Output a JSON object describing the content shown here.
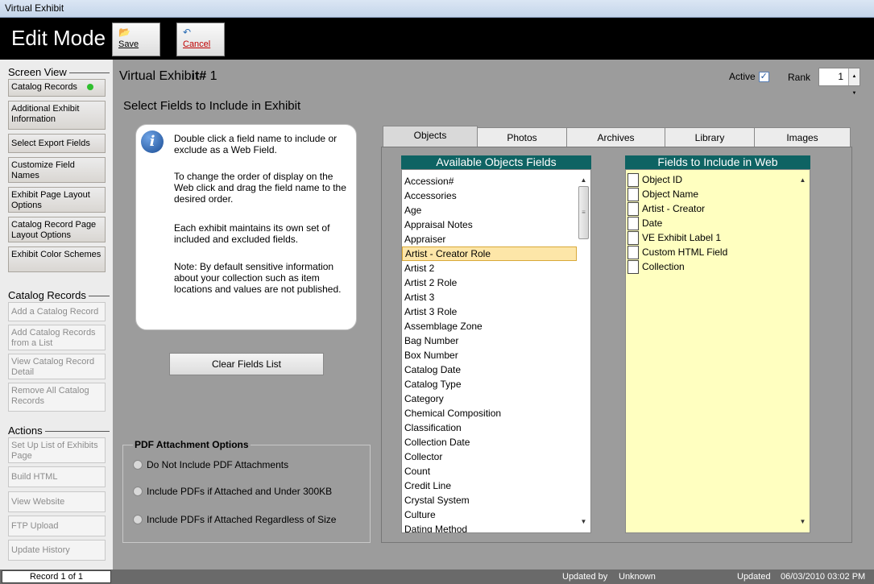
{
  "window": {
    "title": "Virtual Exhibit"
  },
  "toolbar": {
    "mode": "Edit Mode",
    "save_label": "Save",
    "cancel_label": "Cancel"
  },
  "sidebar": {
    "screen_view_heading": "Screen View",
    "screen_view_items": [
      "Catalog Records",
      "Additional Exhibit Information",
      "Select Export Fields",
      "Customize Field Names",
      "Exhibit Page Layout Options",
      "Catalog Record Page Layout Options",
      "Exhibit Color Schemes"
    ],
    "catalog_heading": "Catalog Records",
    "catalog_items": [
      "Add a Catalog Record",
      "Add Catalog Records from a List",
      "View Catalog Record Detail",
      "Remove All Catalog Records"
    ],
    "actions_heading": "Actions",
    "action_items": [
      "Set Up List of Exhibits Page",
      "Build HTML",
      "View Website",
      "FTP Upload",
      "Update History"
    ]
  },
  "header": {
    "title_prefix": "Virtual Exhib",
    "title_bold": "it#",
    "title_number": "1",
    "subtitle": "Select Fields to Include in Exhibit",
    "active_label": "Active",
    "active_checked": true,
    "rank_label": "Rank",
    "rank_value": "1"
  },
  "info": {
    "p1": "Double click a field name to include or exclude as a Web Field.",
    "p2": "To change the order of display on the Web click and drag the field name to the desired order.",
    "p3": "Each exhibit maintains its own set of included and excluded fields.",
    "p4": "Note: By default sensitive information about your collection such as item locations and values are not published."
  },
  "clear_button": "Clear Fields List",
  "pdf": {
    "title": "PDF Attachment Options",
    "options": [
      "Do Not Include PDF Attachments",
      "Include PDFs if Attached and Under 300KB",
      "Include PDFs if Attached Regardless of Size"
    ]
  },
  "tabs": [
    "Objects",
    "Photos",
    "Archives",
    "Library",
    "Images"
  ],
  "available": {
    "heading": "Available Objects Fields",
    "selected_index": 5,
    "items": [
      "Accession#",
      "Accessories",
      "Age",
      "Appraisal Notes",
      "Appraiser",
      "Artist - Creator Role",
      "Artist 2",
      "Artist 2 Role",
      "Artist 3",
      "Artist 3 Role",
      "Assemblage Zone",
      "Bag Number",
      "Box Number",
      "Catalog Date",
      "Catalog Type",
      "Category",
      "Chemical Composition",
      "Classification",
      "Collection Date",
      "Collector",
      "Count",
      "Credit Line",
      "Crystal System",
      "Culture",
      "Dating Method"
    ]
  },
  "web": {
    "heading": "Fields to Include in Web",
    "items": [
      "Object ID",
      "Object Name",
      "Artist - Creator",
      "Date",
      "VE Exhibit Label 1",
      "Custom HTML Field",
      "Collection"
    ]
  },
  "status": {
    "record": "Record 1 of 1",
    "updated_by_label": "Updated by",
    "updated_by": "Unknown",
    "updated_label": "Updated",
    "updated_date": "06/03/2010 03:02 PM"
  }
}
